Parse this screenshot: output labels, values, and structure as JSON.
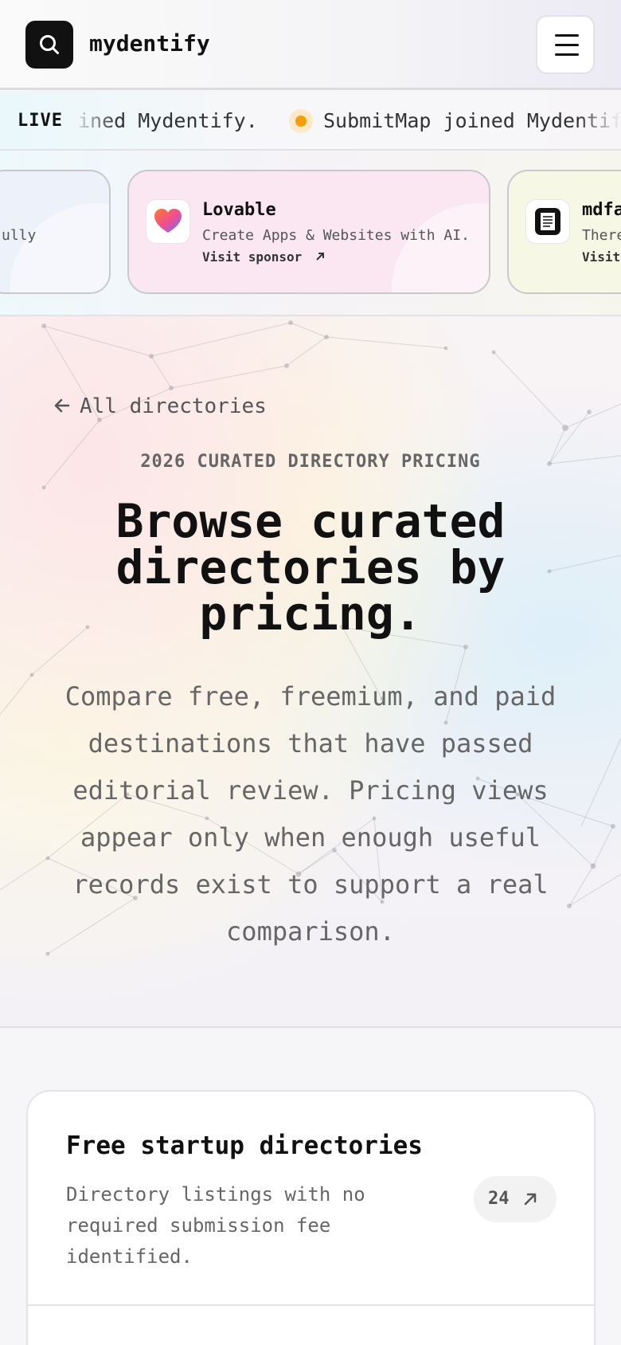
{
  "header": {
    "brand": "mydentify",
    "logo_icon": "search-icon",
    "menu_icon": "hamburger-menu-icon"
  },
  "ticker": {
    "live_label": "LIVE",
    "items": [
      "ined Mydentify.",
      "SubmitMap joined Mydentify."
    ],
    "dot_color": "#f59e0b"
  },
  "sponsors": [
    {
      "title": "",
      "desc": "ully",
      "link": ""
    },
    {
      "title": "Lovable",
      "desc": "Create Apps & Websites with AI.",
      "link": "Visit sponsor",
      "icon": "lovable-heart-icon"
    },
    {
      "title": "mdfa",
      "desc": "There",
      "link": "Visit",
      "icon": "document-icon"
    }
  ],
  "hero": {
    "back_label": "All directories",
    "eyebrow": "2026 CURATED DIRECTORY PRICING",
    "title": "Browse curated directories by pricing.",
    "subtitle": "Compare free, freemium, and paid destinations that have passed editorial review. Pricing views appear only when enough useful records exist to support a real comparison."
  },
  "list": {
    "title": "Free startup directories",
    "desc": "Directory listings with no required submission fee identified.",
    "count": "24"
  }
}
